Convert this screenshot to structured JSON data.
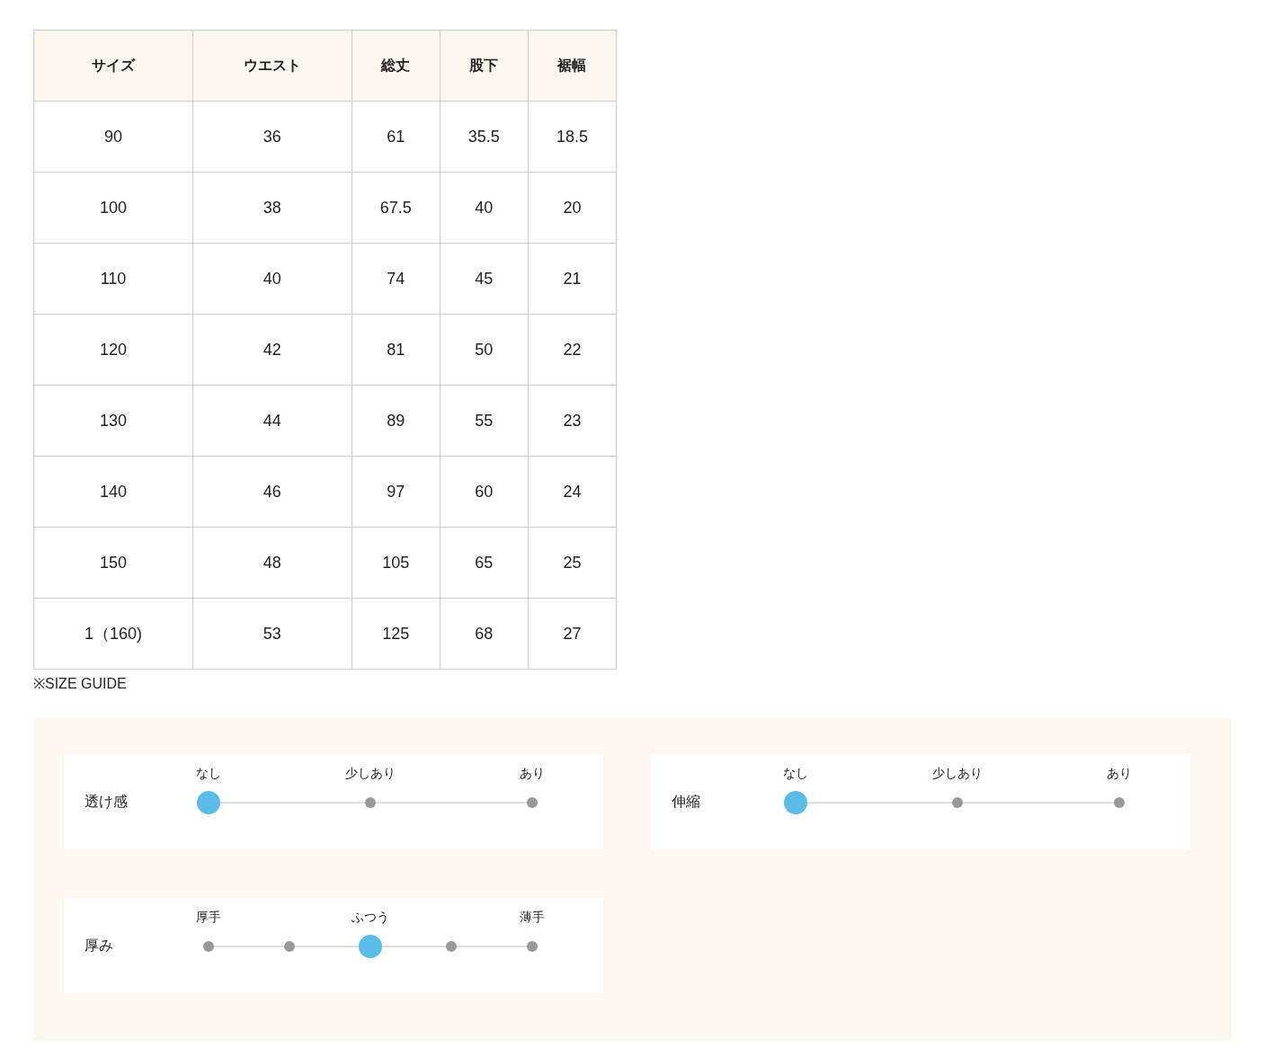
{
  "size_table": {
    "columns": [
      "サイズ",
      "ウエスト",
      "総丈",
      "股下",
      "裾幅"
    ],
    "rows": [
      [
        "90",
        "36",
        "61",
        "35.5",
        "18.5"
      ],
      [
        "100",
        "38",
        "67.5",
        "40",
        "20"
      ],
      [
        "110",
        "40",
        "74",
        "45",
        "21"
      ],
      [
        "120",
        "42",
        "81",
        "50",
        "22"
      ],
      [
        "130",
        "44",
        "89",
        "55",
        "23"
      ],
      [
        "140",
        "46",
        "97",
        "60",
        "24"
      ],
      [
        "150",
        "48",
        "105",
        "65",
        "25"
      ],
      [
        "1（160)",
        "53",
        "125",
        "68",
        "27"
      ]
    ]
  },
  "caption": "※SIZE GUIDE",
  "scales": [
    {
      "label": "透け感",
      "points": [
        {
          "label": "なし",
          "selected": true
        },
        {
          "label": "少しあり",
          "selected": false
        },
        {
          "label": "あり",
          "selected": false
        }
      ]
    },
    {
      "label": "伸縮",
      "points": [
        {
          "label": "なし",
          "selected": true
        },
        {
          "label": "少しあり",
          "selected": false
        },
        {
          "label": "あり",
          "selected": false
        }
      ]
    },
    {
      "label": "厚み",
      "points": [
        {
          "label": "厚手",
          "selected": false
        },
        {
          "selected": false
        },
        {
          "label": "ふつう",
          "selected": true
        },
        {
          "selected": false
        },
        {
          "label": "薄手",
          "selected": false
        }
      ]
    }
  ]
}
